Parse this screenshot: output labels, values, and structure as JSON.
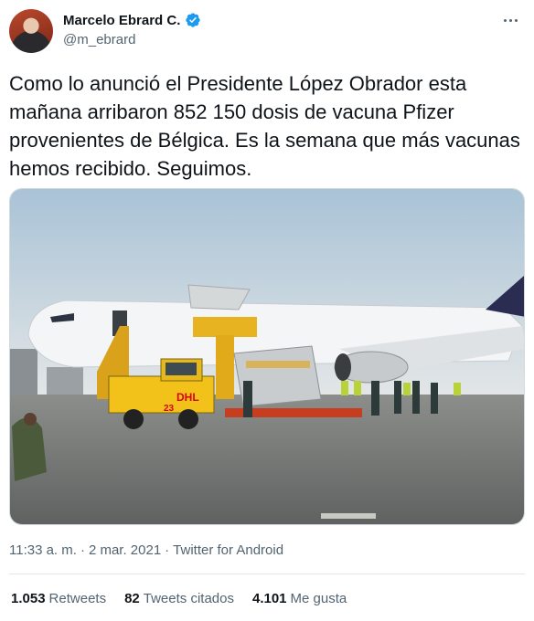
{
  "author": {
    "display_name": "Marcelo Ebrard C.",
    "handle": "@m_ebrard",
    "verified": true
  },
  "icons": {
    "verified": "verified-badge-icon",
    "more": "more-options-icon"
  },
  "tweet": {
    "text": "Como lo anunció el Presidente López Obrador esta\nmañana arribaron 852 150 dosis de vacuna Pfizer\nprovenientes de Bélgica. Es la semana que más vacunas\nhemos recibido. Seguimos.",
    "image_logo_text": "DHL",
    "image_vehicle_number": "23"
  },
  "meta": {
    "time": "11:33 a. m.",
    "separator1": "·",
    "date": "2 mar. 2021",
    "separator2": "·",
    "source": "Twitter for Android"
  },
  "stats": {
    "retweets_count": "1.053",
    "retweets_label": "Retweets",
    "quotes_count": "82",
    "quotes_label": "Tweets citados",
    "likes_count": "4.101",
    "likes_label": "Me gusta"
  },
  "colors": {
    "verified": "#1d9bf0",
    "secondary_text": "#536471",
    "primary_text": "#0f1419"
  }
}
